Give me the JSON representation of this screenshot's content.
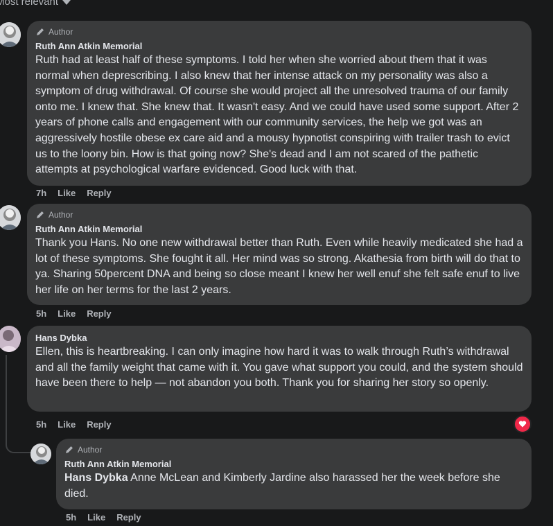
{
  "sort": {
    "label": "Most relevant"
  },
  "comments": [
    {
      "author_tag": "Author",
      "name": "Ruth Ann Atkin Memorial",
      "text": "Ruth had at least half of these symptoms. I told her when she worried about them that it was normal when deprescribing. I also knew that her intense attack on my personality was also a symptom of drug withdrawal. Of course she would project all the unresolved trauma of our family onto me. I knew that. She knew that. It wasn't easy. And we could have used some support. After 2 years of phone calls and engagement with our community services, the help we got was an aggressively hostile obese ex care aid and a mousy hypnotist conspiring with trailer trash to evict us to the loony bin. How is that going now? She's dead and I am not scared of the pathetic attempts at psychological warfare evidenced. Good luck with that.",
      "time": "7h",
      "like": "Like",
      "reply": "Reply"
    },
    {
      "author_tag": "Author",
      "name": "Ruth Ann Atkin Memorial",
      "text": "Thank you Hans. No one new withdrawal better than Ruth. Even while heavily medicated she had a lot of these symptoms. She fought it all. Her mind was so strong. Akathesia from birth will do that to ya. Sharing 50percent DNA and being so close meant I knew her well enuf she felt safe enuf to live her life on her terms for the last 2 years.",
      "time": "5h",
      "like": "Like",
      "reply": "Reply"
    },
    {
      "name": "Hans Dybka",
      "text": "Ellen, this is heartbreaking. I can only imagine how hard it was to walk through Ruth’s withdrawal and all the family weight that came with it. You gave what support you could, and the system should have been there to help — not abandon you both. Thank you for sharing her story so openly.",
      "time": "5h",
      "like": "Like",
      "reply": "Reply",
      "reaction": "love"
    },
    {
      "author_tag": "Author",
      "name": "Ruth Ann Atkin Memorial",
      "mention": "Hans Dybka",
      "text": " Anne McLean and Kimberly Jardine also harassed her the week before she died.",
      "time": "5h",
      "like": "Like",
      "reply": "Reply"
    }
  ],
  "colors": {
    "bubble": "#3a3b3c",
    "background": "#18191a",
    "muted": "#b0b3b8",
    "love": "#f02849"
  }
}
